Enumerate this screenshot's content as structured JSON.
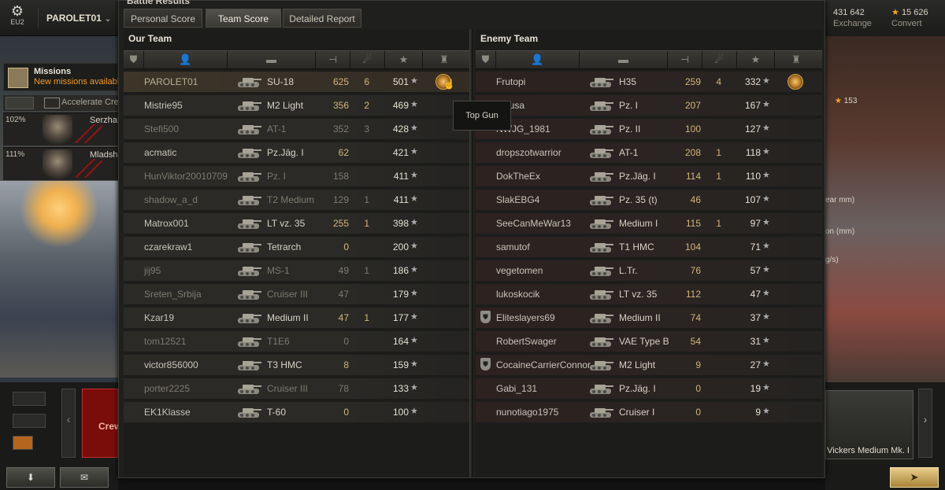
{
  "app": {
    "server": "EU2",
    "player_menu": "PAROLET01",
    "gold_amount": "431 642",
    "gold_label": "Exchange",
    "credits_amount": "15 626",
    "credits_label": "Convert"
  },
  "hangar": {
    "missions_title": "Missions",
    "missions_sub": "New missions available",
    "accelerate": "Accelerate Crew",
    "crew": [
      {
        "pct": "102%",
        "name": "Serzhant"
      },
      {
        "pct": "111%",
        "name": "Mladshiy"
      }
    ],
    "right_texts": [
      "153",
      "ear mm)",
      "on (mm)",
      "g/s)"
    ],
    "left_card_text": "Crew",
    "right_card_name": "Vickers Medium Mk. I"
  },
  "window": {
    "title": "Battle Results",
    "tabs": [
      "Personal Score",
      "Team Score",
      "Detailed Report"
    ],
    "active_tab": 1,
    "tooltip": "Top Gun"
  },
  "our_team": {
    "title": "Our Team",
    "rows": [
      {
        "player": "PAROLET01",
        "tank": "SU-18",
        "damage": "625",
        "frags": "6",
        "xp": "501",
        "medal": true,
        "is_player": true,
        "dim": false
      },
      {
        "player": "Mistrie95",
        "tank": "M2 Light",
        "damage": "356",
        "frags": "2",
        "xp": "469",
        "dim": false
      },
      {
        "player": "Stefi500",
        "tank": "AT-1",
        "damage": "352",
        "frags": "3",
        "xp": "428",
        "dim": true
      },
      {
        "player": "acmatic",
        "tank": "Pz.Jäg. I",
        "damage": "62",
        "frags": "",
        "xp": "421",
        "dim": false
      },
      {
        "player": "HunViktor20010709",
        "tank": "Pz. I",
        "damage": "158",
        "frags": "",
        "xp": "411",
        "dim": true
      },
      {
        "player": "shadow_a_d",
        "tank": "T2 Medium",
        "damage": "129",
        "frags": "1",
        "xp": "411",
        "dim": true
      },
      {
        "player": "Matrox001",
        "tank": "LT vz. 35",
        "damage": "255",
        "frags": "1",
        "xp": "398",
        "dim": false
      },
      {
        "player": "czarekraw1",
        "tank": "Tetrarch",
        "damage": "0",
        "frags": "",
        "xp": "200",
        "dim": false
      },
      {
        "player": "jij95",
        "tank": "MS-1",
        "damage": "49",
        "frags": "1",
        "xp": "186",
        "dim": true
      },
      {
        "player": "Sreten_Srbija",
        "tank": "Cruiser III",
        "damage": "47",
        "frags": "",
        "xp": "179",
        "dim": true
      },
      {
        "player": "Kzar19",
        "tank": "Medium II",
        "damage": "47",
        "frags": "1",
        "xp": "177",
        "dim": false
      },
      {
        "player": "tom12521",
        "tank": "T1E6",
        "damage": "0",
        "frags": "",
        "xp": "164",
        "dim": true
      },
      {
        "player": "victor856000",
        "tank": "T3 HMC",
        "damage": "8",
        "frags": "",
        "xp": "159",
        "dim": false
      },
      {
        "player": "porter2225",
        "tank": "Cruiser III",
        "damage": "78",
        "frags": "",
        "xp": "133",
        "dim": true
      },
      {
        "player": "EK1Klasse",
        "tank": "T-60",
        "damage": "0",
        "frags": "",
        "xp": "100",
        "dim": false
      }
    ]
  },
  "enemy_team": {
    "title": "Enemy Team",
    "rows": [
      {
        "player": "Frutopi",
        "tank": "H35",
        "damage": "259",
        "frags": "4",
        "xp": "332",
        "medal": true,
        "dim": false
      },
      {
        "player": "Mausa",
        "tank": "Pz. I",
        "damage": "207",
        "frags": "",
        "xp": "167",
        "dim": false
      },
      {
        "player": "NWJG_1981",
        "tank": "Pz. II",
        "damage": "100",
        "frags": "",
        "xp": "127",
        "dim": false
      },
      {
        "player": "dropszotwarrior",
        "tank": "AT-1",
        "damage": "208",
        "frags": "1",
        "xp": "118",
        "dim": false
      },
      {
        "player": "DokTheEx",
        "tank": "Pz.Jäg. I",
        "damage": "114",
        "frags": "1",
        "xp": "110",
        "dim": false
      },
      {
        "player": "SlakEBG4",
        "tank": "Pz. 35 (t)",
        "damage": "46",
        "frags": "",
        "xp": "107",
        "dim": false
      },
      {
        "player": "SeeCanMeWar13",
        "tank": "Medium I",
        "damage": "115",
        "frags": "1",
        "xp": "97",
        "dim": false
      },
      {
        "player": "samutof",
        "tank": "T1 HMC",
        "damage": "104",
        "frags": "",
        "xp": "71",
        "dim": false
      },
      {
        "player": "vegetomen",
        "tank": "L.Tr.",
        "damage": "76",
        "frags": "",
        "xp": "57",
        "dim": false
      },
      {
        "player": "lukoskocik",
        "tank": "LT vz. 35",
        "damage": "112",
        "frags": "",
        "xp": "47",
        "dim": false
      },
      {
        "player": "Eliteslayers69",
        "tank": "Medium II",
        "damage": "74",
        "frags": "",
        "xp": "37",
        "squad": true,
        "dim": false
      },
      {
        "player": "RobertSwager",
        "tank": "VAE Type B",
        "damage": "54",
        "frags": "",
        "xp": "31",
        "dim": false
      },
      {
        "player": "CocaineCarrierConnor",
        "tank": "M2 Light",
        "damage": "9",
        "frags": "",
        "xp": "27",
        "squad": true,
        "dim": false
      },
      {
        "player": "Gabi_131",
        "tank": "Pz.Jäg. I",
        "damage": "0",
        "frags": "",
        "xp": "19",
        "dim": false
      },
      {
        "player": "nunotiago1975",
        "tank": "Cruiser I",
        "damage": "0",
        "frags": "",
        "xp": "9",
        "dim": false
      }
    ]
  },
  "icons": {
    "columns": [
      "squad-icon",
      "player-icon",
      "tank-icon",
      "damage-icon",
      "frags-icon",
      "xp-icon",
      "medal-icon"
    ]
  }
}
